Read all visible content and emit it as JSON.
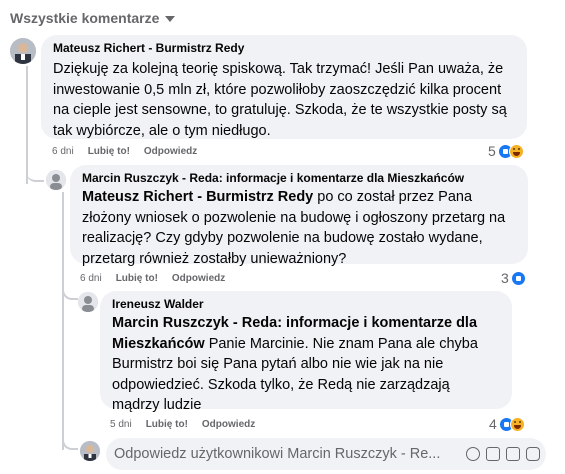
{
  "header": {
    "label": "Wszystkie komentarze"
  },
  "comments": [
    {
      "author": "Mateusz Richert - Burmistrz Redy",
      "text": "Dziękuję za kolejną teorię spiskową. Tak trzymać! Jeśli Pan uważa, że inwestowanie 0,5 mln zł, które pozwoliłoby zaoszczędzić kilka procent na cieple jest sensowne, to gratuluję. Szkoda, że te wszystkie posty są tak wybiórcze, ale o tym niedługo.",
      "time": "6 dni",
      "like": "Lubię to!",
      "reply": "Odpowiedz",
      "reaction_count": "5"
    },
    {
      "author": "Marcin Ruszczyk - Reda: informacje i komentarze dla Mieszkańców",
      "mention": "Mateusz Richert - Burmistrz Redy",
      "text": " po co został przez Pana złożony wniosek o pozwolenie na budowę i ogłoszony przetarg na realizację? Czy gdyby pozwolenie na budowę zostało wydane, przetarg również zostałby unieważniony?",
      "time": "6 dni",
      "like": "Lubię to!",
      "reply": "Odpowiedz",
      "reaction_count": "3"
    },
    {
      "author": "Ireneusz Walder",
      "mention": "Marcin Ruszczyk - Reda: informacje i komentarze dla Mieszkańców",
      "text": " Panie Marcinie. Nie znam Pana ale chyba Burmistrz boi się Pana pytań albo nie wie jak na nie odpowiedzieć. Szkoda tylko, że Redą nie zarządzają mądrzy ludzie",
      "time": "5 dni",
      "like": "Lubię to!",
      "reply": "Odpowiedz",
      "reaction_count": "4"
    }
  ],
  "reply_input": {
    "placeholder": "Odpowiedz użytkownikowi Marcin Ruszczyk - Re..."
  },
  "icons": [
    "caret-down-icon",
    "like-reaction-icon",
    "haha-reaction-icon",
    "emoji-icon",
    "camera-icon",
    "gif-icon",
    "sticker-icon"
  ]
}
